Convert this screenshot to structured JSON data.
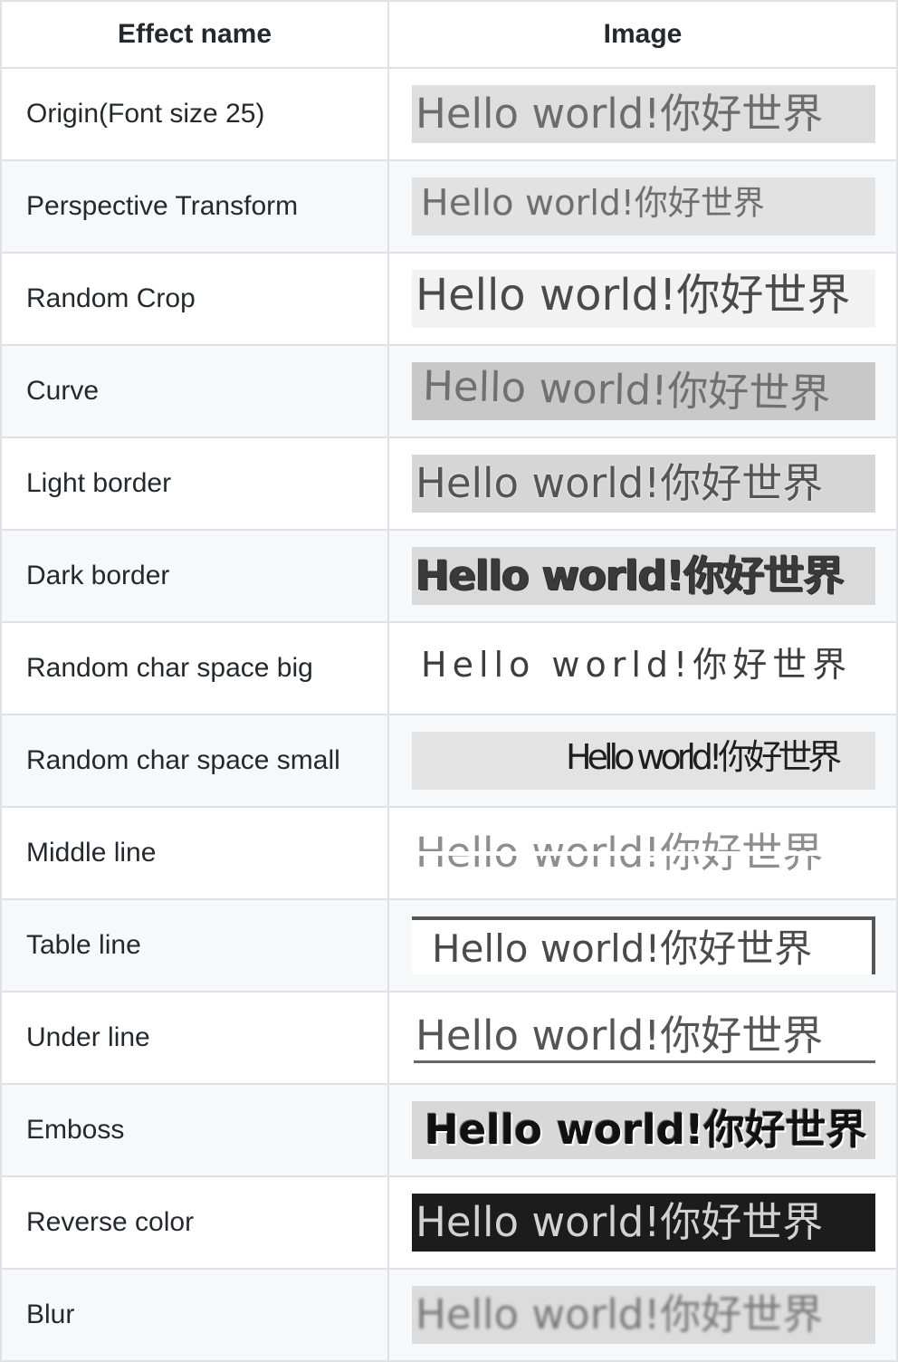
{
  "table": {
    "headers": {
      "effect_name": "Effect name",
      "image": "Image"
    },
    "sample_text": "Hello world!你好世界",
    "rows": [
      {
        "effect": "Origin(Font size 25)"
      },
      {
        "effect": "Perspective Transform"
      },
      {
        "effect": "Random Crop"
      },
      {
        "effect": "Curve"
      },
      {
        "effect": "Light border"
      },
      {
        "effect": "Dark border"
      },
      {
        "effect": "Random char space big"
      },
      {
        "effect": "Random char space small"
      },
      {
        "effect": "Middle line"
      },
      {
        "effect": "Table line"
      },
      {
        "effect": "Under line"
      },
      {
        "effect": "Emboss"
      },
      {
        "effect": "Reverse color"
      },
      {
        "effect": "Blur"
      }
    ]
  }
}
